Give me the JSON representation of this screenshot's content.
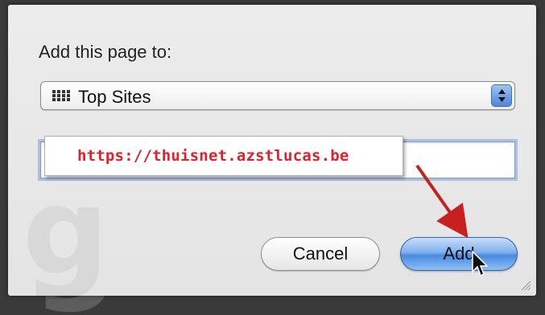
{
  "dialog": {
    "prompt": "Add this page to:",
    "location_popup": {
      "selected": "Top Sites",
      "icon": "top-sites-grid-icon"
    },
    "url_callout": "https://thuisnet.azstlucas.be",
    "buttons": {
      "cancel": "Cancel",
      "add": "Add"
    }
  },
  "colors": {
    "callout_text": "#e0202a",
    "arrow": "#c81f1f",
    "default_button": "#4a8ae0"
  }
}
